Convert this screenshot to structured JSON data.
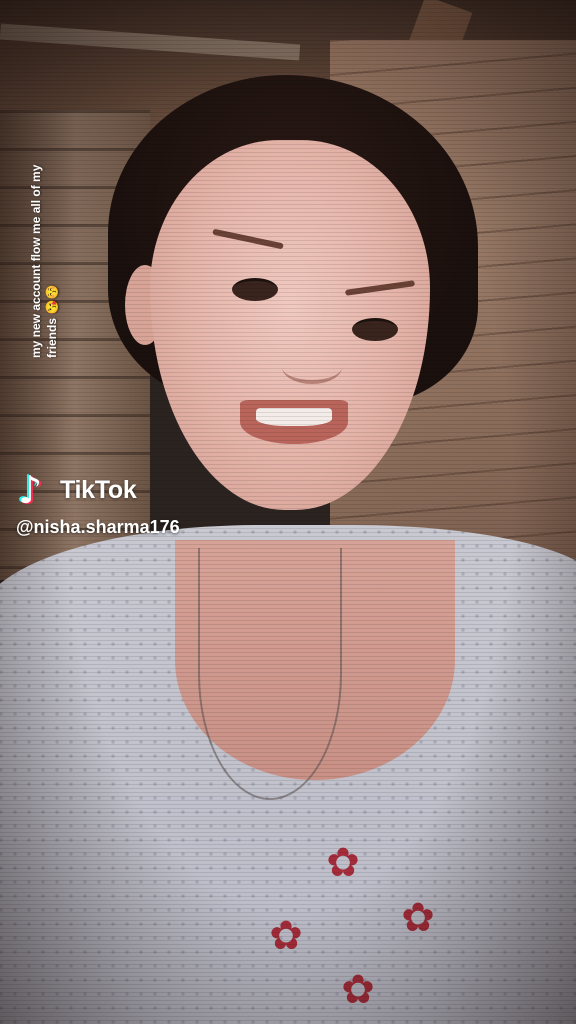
{
  "overlay": {
    "caption": "my new account flow me all of my friends 😘😚",
    "brand": "TikTok",
    "username": "@nisha.sharma176"
  },
  "icons": {
    "logo": "tiktok-note-icon",
    "flower": "flower-embroidery"
  },
  "colors": {
    "tiktok_cyan": "#25f4ee",
    "tiktok_red": "#fe2c55",
    "text": "#ffffff"
  }
}
